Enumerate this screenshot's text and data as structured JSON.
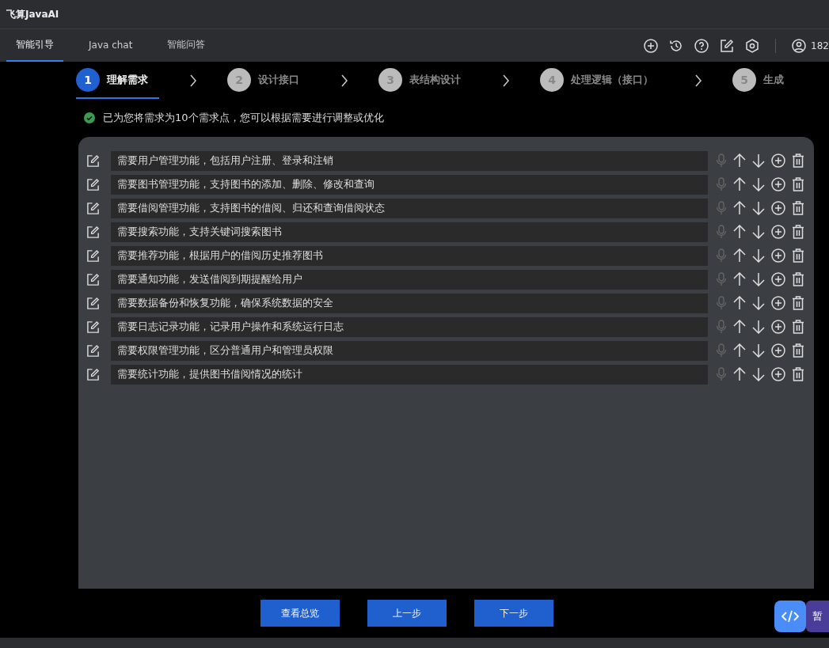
{
  "window": {
    "title": "飞算JavaAI"
  },
  "tabs": [
    {
      "label": "智能引导",
      "selected": true
    },
    {
      "label": "Java chat",
      "selected": false
    },
    {
      "label": "智能问答",
      "selected": false
    }
  ],
  "user": {
    "name": "182"
  },
  "steps": [
    {
      "number": "1",
      "label": "理解需求",
      "selected": true
    },
    {
      "number": "2",
      "label": "设计接口",
      "selected": false
    },
    {
      "number": "3",
      "label": "表结构设计",
      "selected": false
    },
    {
      "number": "4",
      "label": "处理逻辑（接口）",
      "selected": false
    },
    {
      "number": "5",
      "label": "生成",
      "selected": false
    }
  ],
  "notice": "已为您将需求为10个需求点，您可以根据需要进行调整或优化",
  "requirements": [
    {
      "text": "需要用户管理功能，包括用户注册、登录和注销"
    },
    {
      "text": "需要图书管理功能，支持图书的添加、删除、修改和查询"
    },
    {
      "text": "需要借阅管理功能，支持图书的借阅、归还和查询借阅状态"
    },
    {
      "text": "需要搜索功能，支持关键词搜索图书"
    },
    {
      "text": "需要推荐功能，根据用户的借阅历史推荐图书"
    },
    {
      "text": "需要通知功能，发送借阅到期提醒给用户"
    },
    {
      "text": "需要数据备份和恢复功能，确保系统数据的安全"
    },
    {
      "text": "需要日志记录功能，记录用户操作和系统运行日志"
    },
    {
      "text": "需要权限管理功能，区分普通用户和管理员权限"
    },
    {
      "text": "需要统计功能，提供图书借阅情况的统计"
    }
  ],
  "mic_disabled": true,
  "buttons": [
    "查看总览",
    "上一步",
    "下一步"
  ],
  "float_label": "暂"
}
